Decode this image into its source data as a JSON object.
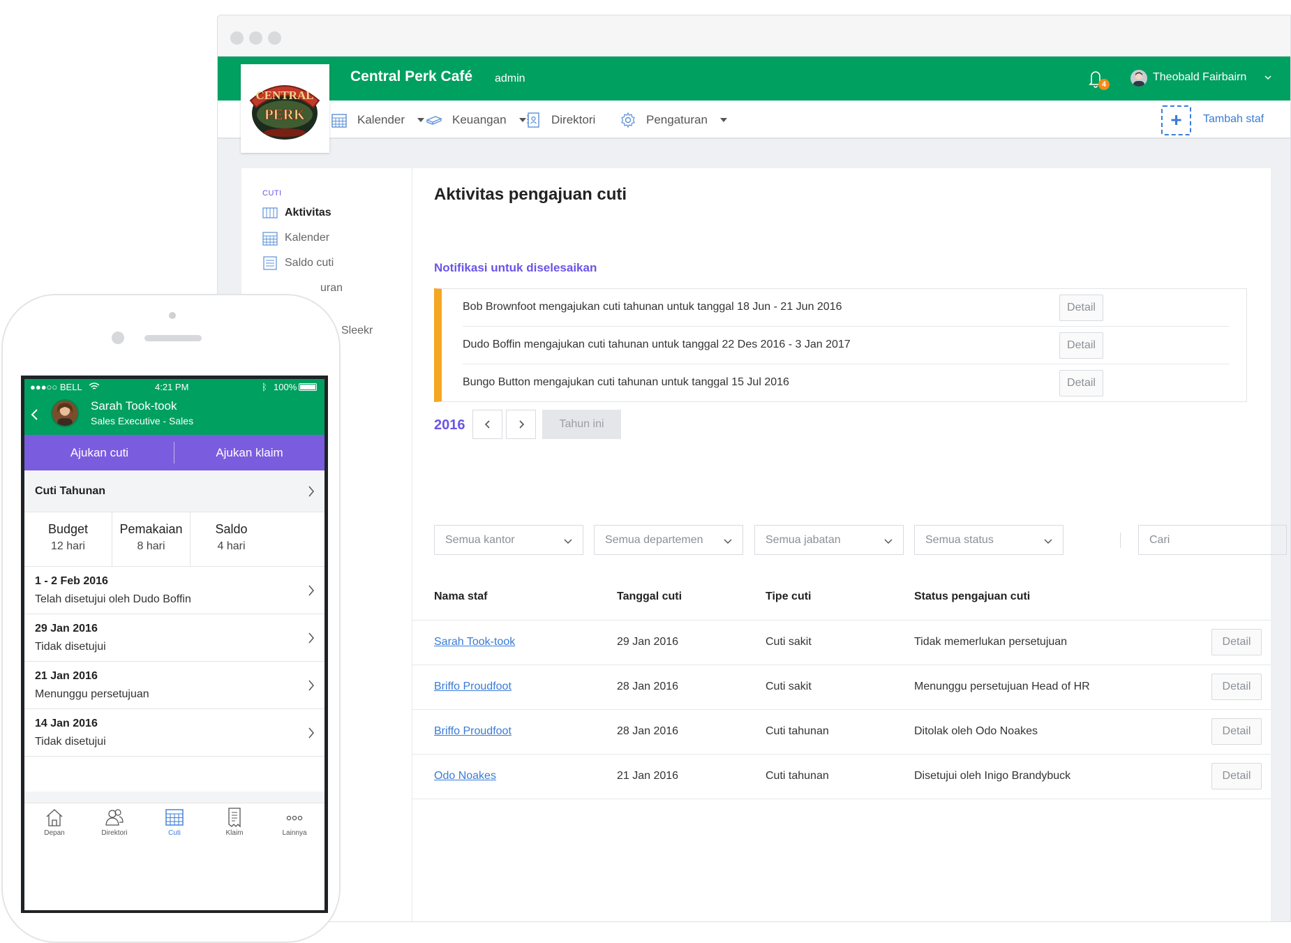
{
  "app": {
    "name": "Central Perk Café",
    "role": "admin",
    "notification_count": "4",
    "user_name": "Theobald Fairbairn",
    "add_staff_label": "Tambah staf"
  },
  "nav": {
    "items": [
      {
        "label": "Kalender",
        "icon": "calendar-icon",
        "dropdown": true
      },
      {
        "label": "Keuangan",
        "icon": "money-icon",
        "dropdown": true
      },
      {
        "label": "Direktori",
        "icon": "directory-icon",
        "dropdown": false
      },
      {
        "label": "Pengaturan",
        "icon": "gear-icon",
        "dropdown": true
      }
    ]
  },
  "sidebar": {
    "section": "CUTI",
    "items": [
      {
        "label": "Aktivitas",
        "active": true
      },
      {
        "label": "Kalender",
        "active": false
      },
      {
        "label": "Saldo cuti",
        "active": false
      }
    ],
    "partial_items": [
      "uran",
      "Sleekr"
    ]
  },
  "main": {
    "title": "Aktivitas pengajuan cuti",
    "notif_heading": "Notifikasi untuk diselesaikan",
    "notifications": [
      {
        "text": "Bob Brownfoot mengajukan cuti tahunan untuk tanggal 18 Jun - 21 Jun 2016",
        "button": "Detail"
      },
      {
        "text": "Dudo Boffin mengajukan cuti tahunan untuk tanggal 22 Des 2016 - 3 Jan 2017",
        "button": "Detail"
      },
      {
        "text": "Bungo Button mengajukan cuti tahunan untuk tanggal 15 Jul 2016",
        "button": "Detail"
      }
    ],
    "year": "2016",
    "this_year_label": "Tahun ini",
    "filters": [
      "Semua kantor",
      "Semua departemen",
      "Semua jabatan",
      "Semua status"
    ],
    "search_placeholder": "Cari",
    "table": {
      "headers": [
        "Nama staf",
        "Tanggal cuti",
        "Tipe cuti",
        "Status pengajuan cuti"
      ],
      "rows": [
        {
          "name": "Sarah Took-took",
          "date": "29 Jan 2016",
          "type": "Cuti sakit",
          "status": "Tidak memerlukan persetujuan",
          "button": "Detail"
        },
        {
          "name": "Briffo Proudfoot",
          "date": "28 Jan 2016",
          "type": "Cuti sakit",
          "status": "Menunggu persetujuan Head of HR",
          "button": "Detail"
        },
        {
          "name": "Briffo Proudfoot",
          "date": "28 Jan 2016",
          "type": "Cuti tahunan",
          "status": "Ditolak oleh Odo Noakes",
          "button": "Detail"
        },
        {
          "name": "Odo Noakes",
          "date": "21 Jan 2016",
          "type": "Cuti tahunan",
          "status": "Disetujui oleh Inigo Brandybuck",
          "button": "Detail"
        }
      ]
    }
  },
  "mobile": {
    "status": {
      "carrier": "●●●○○ BELL",
      "time": "4:21 PM",
      "battery": "100%"
    },
    "profile": {
      "name": "Sarah Took-took",
      "role": "Sales Executive - Sales"
    },
    "actions": [
      "Ajukan cuti",
      "Ajukan klaim"
    ],
    "leave_type": "Cuti Tahunan",
    "summary": [
      {
        "label": "Budget",
        "value": "12 hari"
      },
      {
        "label": "Pemakaian",
        "value": "8 hari"
      },
      {
        "label": "Saldo",
        "value": "4 hari"
      }
    ],
    "items": [
      {
        "date": "1 - 2 Feb 2016",
        "status": "Telah disetujui oleh Dudo Boffin"
      },
      {
        "date": "29 Jan 2016",
        "status": "Tidak disetujui"
      },
      {
        "date": "21 Jan 2016",
        "status": "Menunggu persetujuan"
      },
      {
        "date": "14 Jan 2016",
        "status": "Tidak disetujui"
      }
    ],
    "tabs": [
      {
        "label": "Depan",
        "icon": "home-icon"
      },
      {
        "label": "Direktori",
        "icon": "people-icon"
      },
      {
        "label": "Cuti",
        "icon": "calendar-icon",
        "active": true
      },
      {
        "label": "Klaim",
        "icon": "document-icon"
      },
      {
        "label": "Lainnya",
        "icon": "more-icon"
      }
    ]
  },
  "colors": {
    "brand_green": "#00a060",
    "accent_purple": "#6a55e6",
    "link_blue": "#3a7bd5",
    "warning_orange": "#f5a623"
  }
}
